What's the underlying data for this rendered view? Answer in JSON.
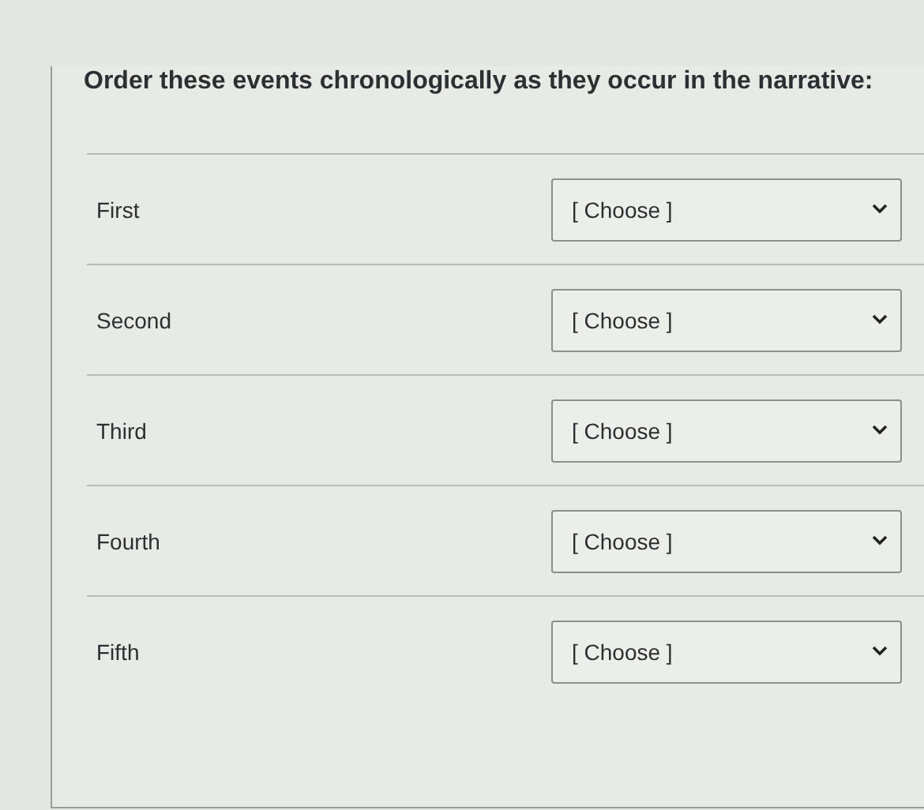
{
  "question": "Order these events chronologically as they occur in the narrative:",
  "rows": [
    {
      "label": "First",
      "value": "[ Choose ]"
    },
    {
      "label": "Second",
      "value": "[ Choose ]"
    },
    {
      "label": "Third",
      "value": "[ Choose ]"
    },
    {
      "label": "Fourth",
      "value": "[ Choose ]"
    },
    {
      "label": "Fifth",
      "value": "[ Choose ]"
    }
  ]
}
